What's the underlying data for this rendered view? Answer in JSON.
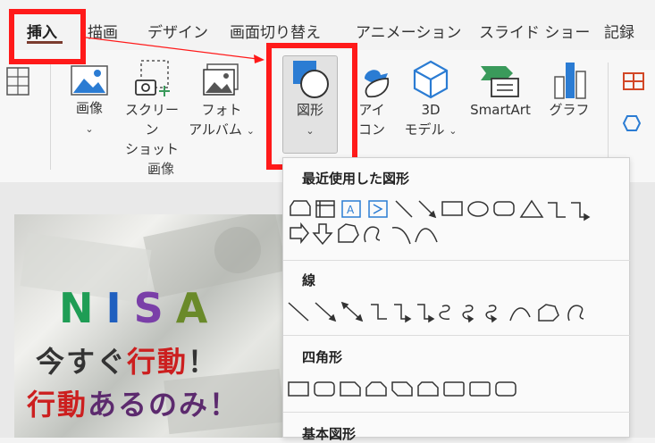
{
  "tabs": [
    {
      "label": "挿入",
      "active": true
    },
    {
      "label": "描画"
    },
    {
      "label": "デザイン"
    },
    {
      "label": "画面切り替え"
    },
    {
      "label": "アニメーション"
    },
    {
      "label": "スライド ショー"
    },
    {
      "label": "記録"
    }
  ],
  "ribbon": {
    "image_line1": "画像",
    "screenshot_line1": "スクリーン",
    "screenshot_line2": "ショット",
    "album_line1": "フォト",
    "album_line2": "アルバム",
    "shapes_label": "図形",
    "icons_line1": "アイ",
    "icons_line2": "コン",
    "model3d_line1": "3D",
    "model3d_line2": "モデル",
    "smartart_label": "SmartArt",
    "chart_label": "グラフ",
    "group_label": "画像",
    "chevron": "⌄"
  },
  "slide": {
    "nisa": [
      "N",
      "I",
      "S",
      "A"
    ],
    "nisa_colors": [
      "#1f9d55",
      "#1f5fbf",
      "#7a3fa8",
      "#6a8a2a"
    ],
    "line1_a": "今すぐ",
    "line1_b": "行動",
    "line1_c": "！",
    "line2_a": "行動",
    "line2_b": "あるのみ！"
  },
  "shapes_panel": {
    "recent_title": "最近使用した図形",
    "lines_title": "線",
    "rect_title": "四角形",
    "basic_title": "基本図形"
  },
  "colors": {
    "highlight": "#ff1a1a",
    "accent_blue": "#2b7cd3",
    "smartart_green": "#3a9a5b",
    "ribbon_orange": "#d24726"
  }
}
